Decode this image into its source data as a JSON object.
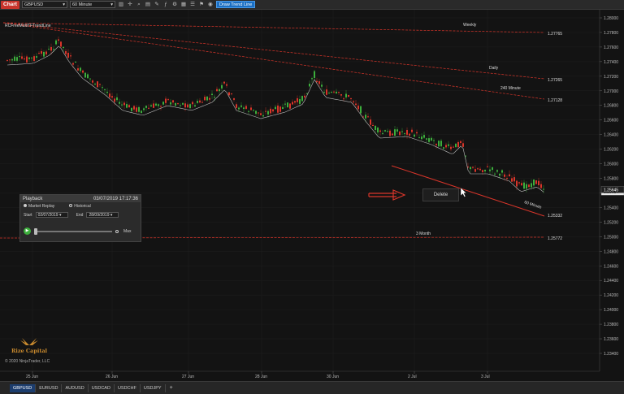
{
  "toolbar": {
    "chart_label": "Chart",
    "instrument": "GBPUSD",
    "interval": "60 Minute",
    "draw_trend_label": "Draw Trend Line"
  },
  "indicator_label": "RCFreeMultiTFTrendLine",
  "price_axis": {
    "ticks": [
      "1.28000",
      "1.27800",
      "1.27600",
      "1.27400",
      "1.27200",
      "1.27000",
      "1.26800",
      "1.26600",
      "1.26400",
      "1.26200",
      "1.26000",
      "1.25800",
      "1.25600",
      "1.25400",
      "1.25200",
      "1.25000",
      "1.24800",
      "1.24600",
      "1.24400",
      "1.24200",
      "1.24000",
      "1.23800",
      "1.23600",
      "1.23400"
    ],
    "current_price": "1.25614",
    "cursor_price": "1.25645"
  },
  "time_axis": {
    "ticks": [
      "25 Jun",
      "26 Jun",
      "27 Jun",
      "28 Jun",
      "30 Jun",
      "2 Jul",
      "3 Jul"
    ]
  },
  "trend_lines": [
    {
      "name": "Weekly",
      "price": "1.27765"
    },
    {
      "name": "Daily",
      "price": "1.27265"
    },
    {
      "name": "240 Minute",
      "price": "1.27128"
    },
    {
      "name": "60 Minute",
      "price": "1.25332"
    },
    {
      "name": "3 Month",
      "price": "1.25772"
    }
  ],
  "playback": {
    "title": "Playback",
    "datetime": "03/07/2019  17:17:36",
    "market_replay_label": "Market Replay",
    "historical_label": "Historical",
    "start_label": "Start",
    "start_date": "02/07/2019",
    "end_label": "End",
    "end_date": "28/09/2019",
    "max_label": "Max"
  },
  "context_menu": {
    "delete_label": "Delete"
  },
  "branding": {
    "logo_text": "Rize Capital",
    "copyright": "© 2020 NinjaTrader, LLC"
  },
  "tabs": [
    "GBPUSD",
    "EURUSD",
    "AUDUSD",
    "USDCAD",
    "USDCHF",
    "USDJPY"
  ],
  "tab_add": "+",
  "colors": {
    "up": "#3cae3c",
    "down": "#d9352a",
    "trend_line": "#d9352a",
    "background": "#131313"
  }
}
